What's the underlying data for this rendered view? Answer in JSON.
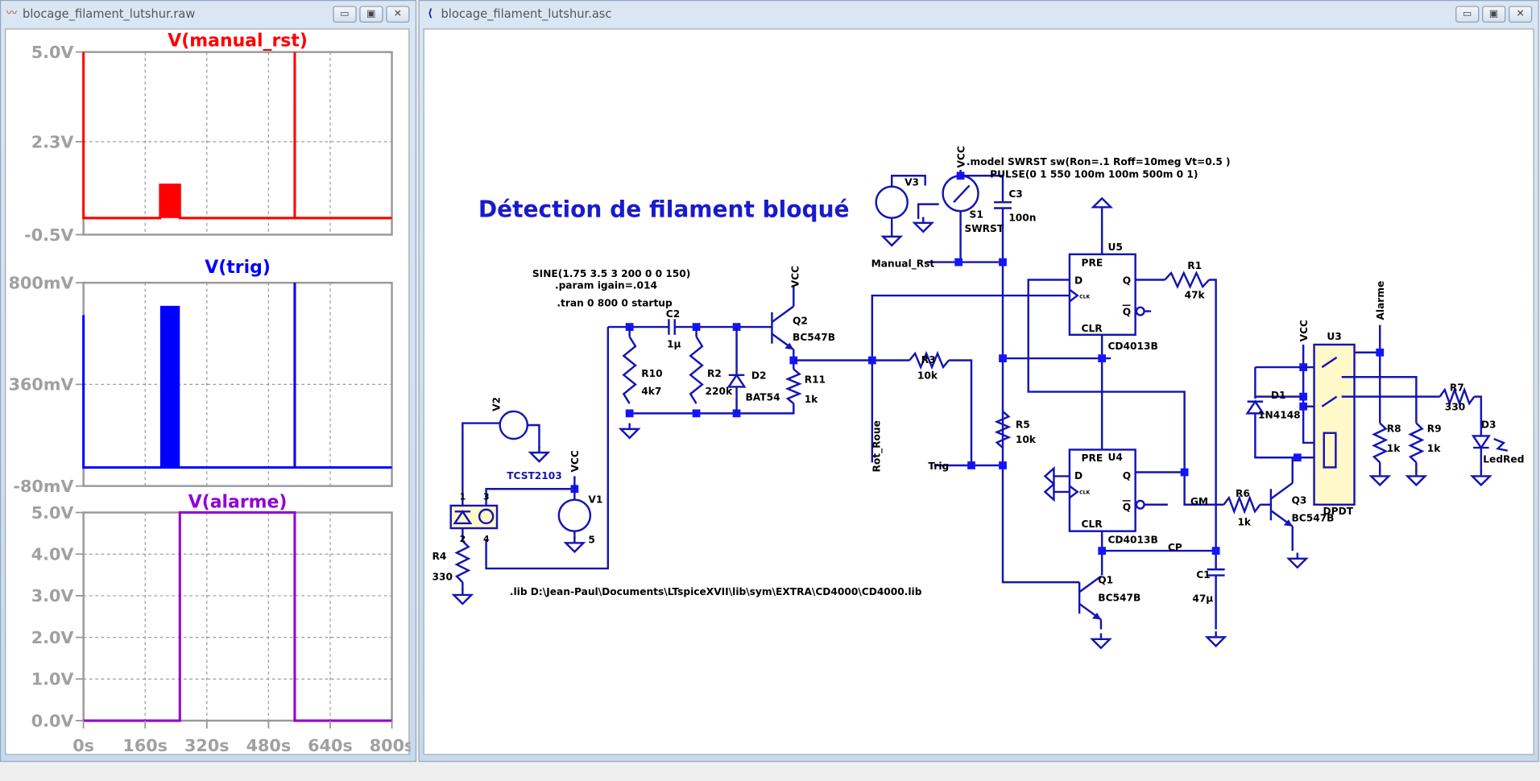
{
  "waveform_window": {
    "title": "blocage_filament_lutshur.raw",
    "icon": "waveform-icon",
    "buttons": {
      "minimize": "▭",
      "maximize": "▣",
      "close": "✕"
    }
  },
  "schematic_window": {
    "title": "blocage_filament_lutshur.asc",
    "icon": "schematic-transistor-icon",
    "buttons": {
      "minimize": "▭",
      "maximize": "▣",
      "close": "✕"
    }
  },
  "chart_data": [
    {
      "type": "line",
      "title": "V(manual_rst)",
      "color": "#ff0000",
      "xlim": [
        0,
        800
      ],
      "xticks": [
        "0s",
        "160s",
        "320s",
        "480s",
        "640s",
        "800s"
      ],
      "ylim": [
        -0.5,
        5.0
      ],
      "yticks": [
        {
          "v": 5.0,
          "label": "5.0V"
        },
        {
          "v": 2.3,
          "label": "2.3V"
        },
        {
          "v": -0.5,
          "label": "-0.5V"
        }
      ],
      "points": [
        [
          0,
          5
        ],
        [
          0,
          0
        ],
        [
          199,
          0
        ],
        [
          199,
          1
        ],
        [
          250,
          1
        ],
        [
          250,
          0
        ],
        [
          548,
          0
        ],
        [
          548,
          5
        ],
        [
          548,
          0
        ],
        [
          800,
          0
        ]
      ],
      "bands": [
        {
          "from": 199,
          "to": 250,
          "level": 1
        }
      ],
      "grid": true
    },
    {
      "type": "line",
      "title": "V(trig)",
      "color": "#0000ff",
      "xlim": [
        0,
        800
      ],
      "ylim": [
        -0.08,
        0.8
      ],
      "yticks": [
        {
          "v": 0.8,
          "label": "800mV"
        },
        {
          "v": 0.36,
          "label": "360mV"
        },
        {
          "v": -0.08,
          "label": "-80mV"
        }
      ],
      "points": [
        [
          0,
          0.66
        ],
        [
          0,
          0
        ],
        [
          548,
          0
        ],
        [
          548,
          0.8
        ],
        [
          548,
          0
        ],
        [
          800,
          0
        ]
      ],
      "bands": [
        {
          "from": 199,
          "to": 250,
          "level": 0.7
        }
      ],
      "grid": true
    },
    {
      "type": "line",
      "title": "V(alarme)",
      "color": "#9400d3",
      "xlim": [
        0,
        800
      ],
      "xticks": [
        "0s",
        "160s",
        "320s",
        "480s",
        "640s",
        "800s"
      ],
      "ylim": [
        0,
        5
      ],
      "yticks": [
        {
          "v": 5,
          "label": "5.0V"
        },
        {
          "v": 4,
          "label": "4.0V"
        },
        {
          "v": 3,
          "label": "3.0V"
        },
        {
          "v": 2,
          "label": "2.0V"
        },
        {
          "v": 1,
          "label": "1.0V"
        },
        {
          "v": 0,
          "label": "0.0V"
        }
      ],
      "points": [
        [
          0,
          0
        ],
        [
          250,
          0
        ],
        [
          250,
          5
        ],
        [
          548,
          5
        ],
        [
          548,
          0
        ],
        [
          800,
          0
        ]
      ],
      "bands": [],
      "grid": true
    }
  ],
  "schematic": {
    "title": "Détection de filament bloqué",
    "directives": {
      "model": ".model  SWRST sw(Ron=.1 Roff=10meg Vt=0.5 )",
      "pulse": "PULSE(0 1 550 100m 100m 500m 0 1)",
      "sine": "SINE(1.75 3.5 3 200 0 0 150)",
      "param": ".param igain=.014",
      "tran": ".tran 0 800 0 startup",
      "lib": ".lib D:\\Jean-Paul\\Documents\\LTspiceXVII\\lib\\sym\\EXTRA\\CD4000\\CD4000.lib"
    },
    "nets": {
      "vcc": "VCC",
      "manual_rst": "Manual_Rst",
      "rot_roue": "Rot_Roue",
      "trig": "Trig",
      "gm": "GM",
      "cp": "CP",
      "alarme": "Alarme"
    },
    "components": {
      "V3": "V3",
      "S1": "S1",
      "S1_model": "SWRST",
      "C3": "C3",
      "C3_val": "100n",
      "U5": "U5",
      "U4": "U4",
      "ff_model": "CD4013B",
      "pre": "PRE",
      "clr": "CLR",
      "d": "D",
      "q": "Q",
      "qbar": "Q",
      "clk": "CLK",
      "R1": "R1",
      "R1_val": "47k",
      "Q2": "Q2",
      "Q2_model": "BC547B",
      "C2": "C2",
      "C2_val": "1µ",
      "R10": "R10",
      "R10_val": "4k7",
      "R2": "R2",
      "R2_val": "220k",
      "D2": "D2",
      "D2_model": "BAT54",
      "R11": "R11",
      "R11_val": "1k",
      "R3": "R3",
      "R3_val": "10k",
      "R5": "R5",
      "R5_val": "10k",
      "R6": "R6",
      "R6_val": "1k",
      "Q3": "Q3",
      "Q3_model": "BC547B",
      "C1": "C1",
      "C1_val": "47µ",
      "Q1": "Q1",
      "Q1_model": "BC547B",
      "V2": "V2",
      "TCST": "TCST2103",
      "V1": "V1",
      "V1_val": "5",
      "R4": "R4",
      "R4_val": "330",
      "pin1": "1",
      "pin2": "2",
      "pin3": "3",
      "pin4": "4",
      "D1": "D1",
      "D1_model": "1N4148",
      "U3": "U3",
      "U3_model": "DPDT",
      "R7": "R7",
      "R7_val": "330",
      "R8": "R8",
      "R8_val": "1k",
      "R9": "R9",
      "R9_val": "1k",
      "D3": "D3",
      "D3_model": "LedRed"
    }
  }
}
